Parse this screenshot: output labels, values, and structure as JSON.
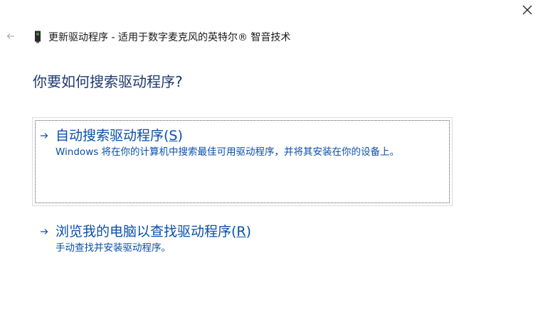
{
  "window": {
    "title": "更新驱动程序 - 适用于数字麦克风的英特尔® 智音技术"
  },
  "icons": {
    "close": "close-icon",
    "back": "back-arrow-icon",
    "device": "device-icon",
    "option_arrow": "arrow-right-icon"
  },
  "colors": {
    "link": "#0a4fa8",
    "heading": "#1e3a6e",
    "text": "#1a1a1a",
    "disabled": "#a0a0a0"
  },
  "main": {
    "heading": "你要如何搜索驱动程序?",
    "options": [
      {
        "title_prefix": "自动搜索驱动程序(",
        "access_key": "S",
        "title_suffix": ")",
        "description": "Windows 将在你的计算机中搜索最佳可用驱动程序，并将其安装在你的设备上。"
      },
      {
        "title_prefix": "浏览我的电脑以查找驱动程序(",
        "access_key": "R",
        "title_suffix": ")",
        "description": "手动查找并安装驱动程序。"
      }
    ]
  }
}
